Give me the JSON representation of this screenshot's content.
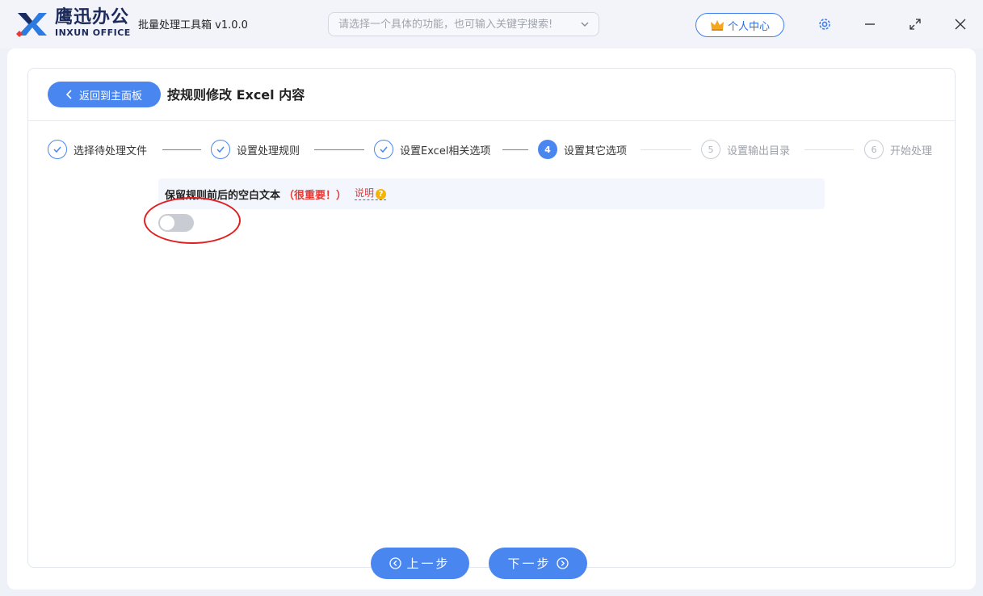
{
  "app": {
    "brand_name": "鹰迅办公",
    "brand_sub": "INXUN OFFICE",
    "title": "批量处理工具箱 v1.0.0"
  },
  "search": {
    "placeholder": "请选择一个具体的功能，也可输入关键字搜索!"
  },
  "header": {
    "user_center": "个人中心"
  },
  "page": {
    "back_label": "返回到主面板",
    "title": "按规则修改 Excel 内容"
  },
  "steps": [
    {
      "number": "1",
      "label": "选择待处理文件",
      "state": "done"
    },
    {
      "number": "2",
      "label": "设置处理规则",
      "state": "done"
    },
    {
      "number": "3",
      "label": "设置Excel相关选项",
      "state": "done"
    },
    {
      "number": "4",
      "label": "设置其它选项",
      "state": "active"
    },
    {
      "number": "5",
      "label": "设置输出目录",
      "state": "todo"
    },
    {
      "number": "6",
      "label": "开始处理",
      "state": "todo"
    }
  ],
  "option": {
    "label": "保留规则前后的空白文本",
    "warning": "（很重要！）",
    "help": "说明",
    "help_icon": "?",
    "enabled": false
  },
  "nav": {
    "prev": "上一步",
    "next": "下一步"
  },
  "colors": {
    "accent": "#4a86f0",
    "warning": "#e53935",
    "highlight": "#e02020"
  }
}
